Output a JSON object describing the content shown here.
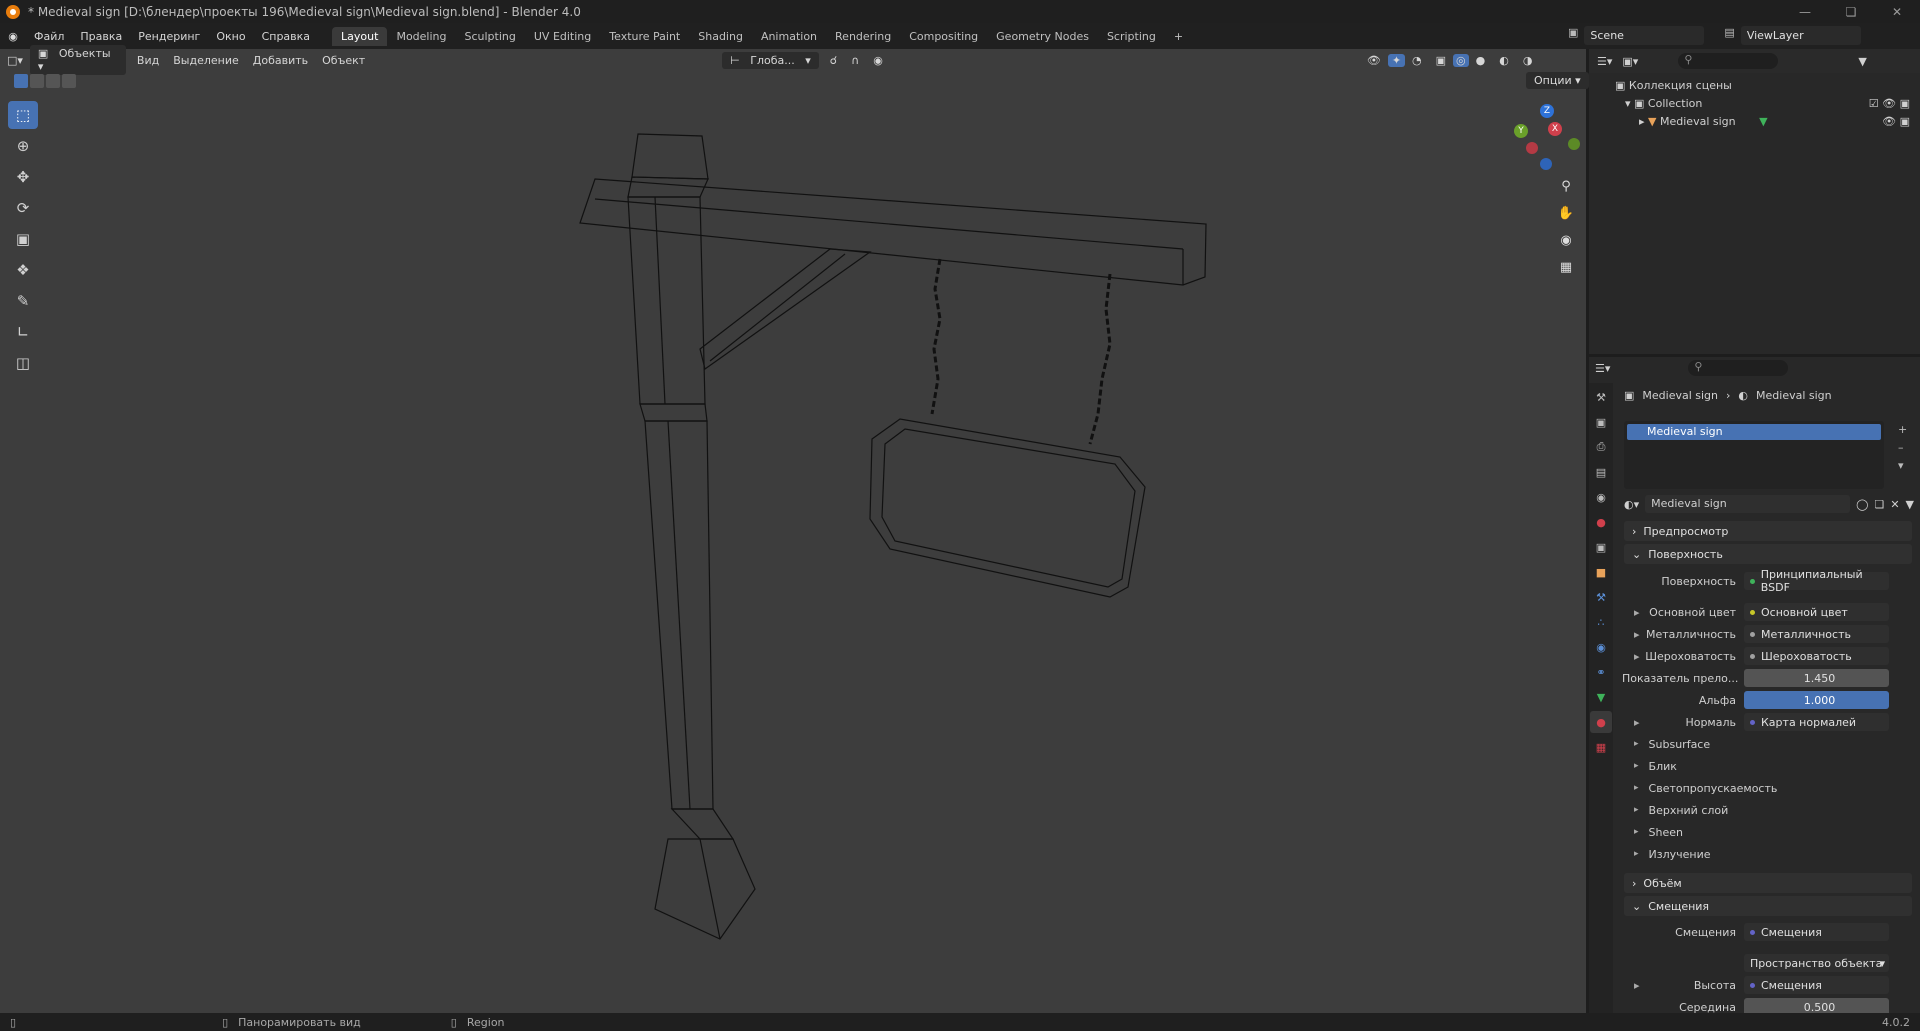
{
  "window": {
    "title": "* Medieval sign [D:\\блендер\\проекты 196\\Medieval sign\\Medieval sign.blend] - Blender 4.0"
  },
  "menu": [
    "Файл",
    "Правка",
    "Рендеринг",
    "Окно",
    "Справка"
  ],
  "workspaces": [
    "Layout",
    "Modeling",
    "Sculpting",
    "UV Editing",
    "Texture Paint",
    "Shading",
    "Animation",
    "Rendering",
    "Compositing",
    "Geometry Nodes",
    "Scripting"
  ],
  "active_workspace": "Layout",
  "scene": {
    "name": "Scene",
    "view_layer": "ViewLayer"
  },
  "viewport": {
    "mode": "Объекты",
    "menus": [
      "Вид",
      "Выделение",
      "Добавить",
      "Объект"
    ],
    "orientation": "Глоба...",
    "options": "Опции"
  },
  "gizmo": {
    "z": "Z",
    "y": "Y",
    "x": "X"
  },
  "outliner": {
    "root": "Коллекция сцены",
    "collection": "Collection",
    "object": "Medieval sign"
  },
  "properties": {
    "breadcrumb_object": "Medieval sign",
    "breadcrumb_material": "Medieval sign",
    "slot": "Medieval sign",
    "material_name": "Medieval sign",
    "preview": "Предпросмотр",
    "surface_section": "Поверхность",
    "surface_label": "Поверхность",
    "surface_value": "Принципиальный BSDF",
    "inputs": [
      {
        "label": "Основной цвет",
        "value": "Основной цвет"
      },
      {
        "label": "Металличность",
        "value": "Металличность"
      },
      {
        "label": "Шероховатость",
        "value": "Шероховатость"
      }
    ],
    "ior_label": "Показатель прело...",
    "ior_value": "1.450",
    "alpha_label": "Альфа",
    "alpha_value": "1.000",
    "normal_label": "Нормаль",
    "normal_value": "Карта нормалей",
    "subpanels": [
      "Subsurface",
      "Блик",
      "Светопропускаемость",
      "Верхний слой",
      "Sheen",
      "Излучение"
    ],
    "volume_section": "Объём",
    "displacement_section": "Смещения",
    "displacement_label": "Смещения",
    "displacement_value": "Смещения",
    "space_value": "Пространство объекта",
    "height_label": "Высота",
    "height_value": "Смещения",
    "midlevel_label": "Середина",
    "midlevel_value": "0.500"
  },
  "status": {
    "pan": "Панорамировать вид",
    "region": "Region",
    "version": "4.0.2"
  }
}
